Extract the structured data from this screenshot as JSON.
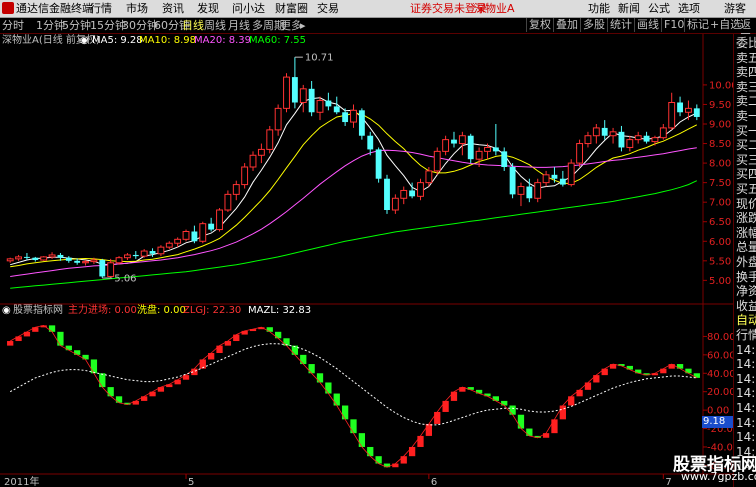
{
  "app": {
    "name": "通达信金融终端"
  },
  "menu": [
    "行情",
    "市场",
    "资讯",
    "发现",
    "问小达",
    "财富圈",
    "交易"
  ],
  "alert_text": "证券交易未登录",
  "stock_title": "深物业A",
  "top_right": [
    "功能",
    "新闻",
    "公式",
    "选项"
  ],
  "guest": "游客",
  "periods": [
    "分时",
    "1分钟",
    "5分钟",
    "15分钟",
    "30分钟",
    "60分钟",
    "日线",
    "周线",
    "月线",
    "多周期",
    "更多"
  ],
  "active_period": "日线",
  "more_arrow": "▸",
  "toolbar": [
    "复权",
    "叠加",
    "多股",
    "统计",
    "画线",
    "F10",
    "标记",
    "+自选",
    "返回"
  ],
  "chart_header": {
    "stock": "深物业A(日线 前复权)",
    "ma": [
      {
        "label": "MA5: 9.28",
        "color": "#ffffff"
      },
      {
        "label": "MA10: 8.98",
        "color": "#ffff00"
      },
      {
        "label": "MA20: 8.39",
        "color": "#ff55ff"
      },
      {
        "label": "MA60: 7.55",
        "color": "#00ff00"
      }
    ]
  },
  "indicator_header": {
    "name": "股票指标网",
    "items": [
      {
        "label": "主力进场: 0.00",
        "color": "#ff3333"
      },
      {
        "label": "洗盘: 0.00",
        "color": "#ffff00"
      },
      {
        "label": "ZLGJ: 22.30",
        "color": "#ff3333"
      },
      {
        "label": "MAZL: 32.83",
        "color": "#ffffff"
      }
    ]
  },
  "right_panel": [
    {
      "t": "委比",
      "c": "white"
    },
    {
      "t": "卖五",
      "c": "white"
    },
    {
      "t": "卖四",
      "c": "white"
    },
    {
      "t": "卖三",
      "c": "white"
    },
    {
      "t": "卖二",
      "c": "white"
    },
    {
      "t": "卖一",
      "c": "white"
    },
    {
      "t": "买一",
      "c": "white"
    },
    {
      "t": "买二",
      "c": "white"
    },
    {
      "t": "买三",
      "c": "white"
    },
    {
      "t": "买四",
      "c": "white"
    },
    {
      "t": "买五",
      "c": "white"
    },
    {
      "t": "现价",
      "c": "white"
    },
    {
      "t": "涨跌",
      "c": "white"
    },
    {
      "t": "涨幅",
      "c": "white"
    },
    {
      "t": "总量",
      "c": "white"
    },
    {
      "t": "外盘",
      "c": "white"
    },
    {
      "t": "换手",
      "c": "white"
    },
    {
      "t": "净资",
      "c": "white"
    },
    {
      "t": "收益",
      "c": "white"
    },
    {
      "t": "自动",
      "c": "yellow"
    },
    {
      "t": "行情",
      "c": "white"
    },
    {
      "t": "14:5",
      "c": "white"
    },
    {
      "t": "14:5",
      "c": "white"
    },
    {
      "t": "14:5",
      "c": "white"
    },
    {
      "t": "14:5",
      "c": "white"
    },
    {
      "t": "14:5",
      "c": "white"
    },
    {
      "t": "14:5",
      "c": "white"
    },
    {
      "t": "14:5",
      "c": "white"
    },
    {
      "t": "14:5",
      "c": "white"
    },
    {
      "t": "14:5",
      "c": "white"
    }
  ],
  "price_box": "9.18",
  "watermark": {
    "line1": "股票指标网",
    "line2": "www.7gpzb.com"
  },
  "annotations": {
    "high": "10.71",
    "low": "5.06"
  },
  "x_labels": [
    "2011年",
    "5",
    "6",
    "7"
  ],
  "chart_data": [
    {
      "type": "candlestick",
      "title": "深物业A(日线 前复权)",
      "ylim": [
        4.6,
        11.2
      ],
      "y_ticks": [
        5.0,
        5.5,
        6.0,
        6.5,
        7.0,
        7.5,
        8.0,
        8.5,
        9.0,
        9.5,
        10.0
      ],
      "candles": [
        [
          5.5,
          5.58,
          5.45,
          5.55
        ],
        [
          5.55,
          5.65,
          5.5,
          5.6
        ],
        [
          5.6,
          5.7,
          5.52,
          5.58
        ],
        [
          5.58,
          5.6,
          5.48,
          5.52
        ],
        [
          5.52,
          5.62,
          5.5,
          5.6
        ],
        [
          5.6,
          5.72,
          5.55,
          5.65
        ],
        [
          5.65,
          5.7,
          5.5,
          5.58
        ],
        [
          5.58,
          5.62,
          5.45,
          5.5
        ],
        [
          5.5,
          5.56,
          5.4,
          5.45
        ],
        [
          5.45,
          5.52,
          5.38,
          5.48
        ],
        [
          5.48,
          5.58,
          5.42,
          5.52
        ],
        [
          5.52,
          5.55,
          5.06,
          5.1
        ],
        [
          5.1,
          5.55,
          5.06,
          5.45
        ],
        [
          5.45,
          5.62,
          5.4,
          5.58
        ],
        [
          5.58,
          5.7,
          5.52,
          5.65
        ],
        [
          5.65,
          5.75,
          5.55,
          5.62
        ],
        [
          5.62,
          5.8,
          5.58,
          5.75
        ],
        [
          5.75,
          5.82,
          5.6,
          5.68
        ],
        [
          5.68,
          5.9,
          5.62,
          5.85
        ],
        [
          5.85,
          6.0,
          5.8,
          5.95
        ],
        [
          5.95,
          6.1,
          5.85,
          6.05
        ],
        [
          6.05,
          6.3,
          6.0,
          6.25
        ],
        [
          6.25,
          6.4,
          5.95,
          6.0
        ],
        [
          6.0,
          6.5,
          5.95,
          6.45
        ],
        [
          6.45,
          6.6,
          6.25,
          6.3
        ],
        [
          6.3,
          6.85,
          6.25,
          6.8
        ],
        [
          6.8,
          7.3,
          6.75,
          7.2
        ],
        [
          7.2,
          7.55,
          7.05,
          7.45
        ],
        [
          7.45,
          8.0,
          7.35,
          7.9
        ],
        [
          7.9,
          8.3,
          7.8,
          8.2
        ],
        [
          8.2,
          8.5,
          8.0,
          8.35
        ],
        [
          8.35,
          8.95,
          8.25,
          8.85
        ],
        [
          8.85,
          9.5,
          8.7,
          9.4
        ],
        [
          9.4,
          10.3,
          9.3,
          10.2
        ],
        [
          10.2,
          10.71,
          9.4,
          9.55
        ],
        [
          9.55,
          10.0,
          9.3,
          9.9
        ],
        [
          9.9,
          10.1,
          9.2,
          9.3
        ],
        [
          9.3,
          9.7,
          9.1,
          9.6
        ],
        [
          9.6,
          9.8,
          9.35,
          9.45
        ],
        [
          9.45,
          9.7,
          9.25,
          9.3
        ],
        [
          9.3,
          9.4,
          8.95,
          9.05
        ],
        [
          9.05,
          9.5,
          8.9,
          9.35
        ],
        [
          9.35,
          9.4,
          8.6,
          8.7
        ],
        [
          8.7,
          8.8,
          8.2,
          8.35
        ],
        [
          8.35,
          8.4,
          7.5,
          7.6
        ],
        [
          7.6,
          7.7,
          6.7,
          6.8
        ],
        [
          6.8,
          7.2,
          6.7,
          7.1
        ],
        [
          7.1,
          7.4,
          6.95,
          7.3
        ],
        [
          7.3,
          7.5,
          7.1,
          7.15
        ],
        [
          7.15,
          7.6,
          7.05,
          7.5
        ],
        [
          7.5,
          7.9,
          7.4,
          7.8
        ],
        [
          7.8,
          8.4,
          7.7,
          8.3
        ],
        [
          8.3,
          8.7,
          8.2,
          8.6
        ],
        [
          8.6,
          8.8,
          8.4,
          8.5
        ],
        [
          8.5,
          8.8,
          8.2,
          8.7
        ],
        [
          8.7,
          8.75,
          8.0,
          8.1
        ],
        [
          8.1,
          8.4,
          7.9,
          8.3
        ],
        [
          8.3,
          8.5,
          8.1,
          8.4
        ],
        [
          8.4,
          9.0,
          8.2,
          8.3
        ],
        [
          8.3,
          8.4,
          7.8,
          7.9
        ],
        [
          7.9,
          8.0,
          7.1,
          7.2
        ],
        [
          7.2,
          7.5,
          6.9,
          7.4
        ],
        [
          7.4,
          7.6,
          7.0,
          7.1
        ],
        [
          7.1,
          7.6,
          7.0,
          7.5
        ],
        [
          7.5,
          7.8,
          7.4,
          7.7
        ],
        [
          7.7,
          7.9,
          7.5,
          7.6
        ],
        [
          7.6,
          7.8,
          7.4,
          7.45
        ],
        [
          7.45,
          8.1,
          7.4,
          8.0
        ],
        [
          8.0,
          8.6,
          7.9,
          8.5
        ],
        [
          8.5,
          8.8,
          8.4,
          8.7
        ],
        [
          8.7,
          9.0,
          8.5,
          8.9
        ],
        [
          8.9,
          9.1,
          8.6,
          8.7
        ],
        [
          8.7,
          8.9,
          8.5,
          8.8
        ],
        [
          8.8,
          8.95,
          8.3,
          8.4
        ],
        [
          8.4,
          8.7,
          8.3,
          8.6
        ],
        [
          8.6,
          8.8,
          8.5,
          8.7
        ],
        [
          8.7,
          8.8,
          8.5,
          8.55
        ],
        [
          8.55,
          8.7,
          8.45,
          8.65
        ],
        [
          8.65,
          9.0,
          8.6,
          8.9
        ],
        [
          8.9,
          9.8,
          8.85,
          9.55
        ],
        [
          9.55,
          9.7,
          9.2,
          9.3
        ],
        [
          9.3,
          9.6,
          9.1,
          9.4
        ],
        [
          9.4,
          9.5,
          9.1,
          9.18
        ]
      ],
      "series": [
        {
          "name": "MA5",
          "color": "#ffffff",
          "values": [
            5.4,
            5.46,
            5.52,
            5.56,
            5.57,
            5.59,
            5.59,
            5.57,
            5.55,
            5.52,
            5.49,
            5.41,
            5.4,
            5.42,
            5.44,
            5.48,
            5.62,
            5.66,
            5.71,
            5.77,
            5.85,
            5.96,
            6.02,
            6.14,
            6.21,
            6.36,
            6.6,
            6.84,
            7.13,
            7.51,
            7.82,
            8.15,
            8.52,
            8.98,
            9.27,
            9.58,
            9.65,
            9.67,
            9.56,
            9.51,
            9.34,
            9.35,
            9.17,
            8.9,
            8.6,
            8.2,
            7.93,
            7.68,
            7.38,
            7.27,
            7.4,
            7.7,
            7.99,
            8.24,
            8.45,
            8.5,
            8.47,
            8.45,
            8.38,
            8.22,
            7.9,
            7.66,
            7.48,
            7.36,
            7.4,
            7.42,
            7.54,
            7.65,
            7.87,
            8.1,
            8.36,
            8.58,
            8.78,
            8.7,
            8.68,
            8.64,
            8.61,
            8.64,
            8.69,
            8.85,
            9.05,
            9.18,
            9.28
          ]
        },
        {
          "name": "MA10",
          "color": "#ffff00",
          "values": [
            5.35,
            5.38,
            5.42,
            5.45,
            5.48,
            5.5,
            5.52,
            5.54,
            5.55,
            5.56,
            5.55,
            5.53,
            5.5,
            5.49,
            5.48,
            5.49,
            5.52,
            5.54,
            5.58,
            5.62,
            5.66,
            5.73,
            5.8,
            5.88,
            5.97,
            6.07,
            6.24,
            6.41,
            6.61,
            6.83,
            7.05,
            7.3,
            7.58,
            7.88,
            8.17,
            8.47,
            8.7,
            8.91,
            9.05,
            9.18,
            9.22,
            9.27,
            9.25,
            9.13,
            8.97,
            8.75,
            8.55,
            8.37,
            8.14,
            7.94,
            7.8,
            7.75,
            7.75,
            7.79,
            7.86,
            7.95,
            8.04,
            8.1,
            8.17,
            8.2,
            8.15,
            8.06,
            7.96,
            7.8,
            7.66,
            7.56,
            7.48,
            7.48,
            7.58,
            7.73,
            7.89,
            8.02,
            8.13,
            8.18,
            8.24,
            8.33,
            8.4,
            8.49,
            8.56,
            8.66,
            8.76,
            8.87,
            8.98
          ]
        },
        {
          "name": "MA20",
          "color": "#ff55ff",
          "values": [
            5.1,
            5.13,
            5.16,
            5.19,
            5.22,
            5.25,
            5.28,
            5.31,
            5.33,
            5.35,
            5.37,
            5.38,
            5.4,
            5.42,
            5.44,
            5.46,
            5.48,
            5.5,
            5.52,
            5.55,
            5.58,
            5.62,
            5.66,
            5.71,
            5.76,
            5.82,
            5.9,
            5.98,
            6.08,
            6.19,
            6.31,
            6.45,
            6.6,
            6.76,
            6.93,
            7.1,
            7.28,
            7.46,
            7.62,
            7.78,
            7.93,
            8.06,
            8.18,
            8.26,
            8.32,
            8.33,
            8.32,
            8.3,
            8.27,
            8.23,
            8.18,
            8.14,
            8.1,
            8.06,
            8.02,
            7.99,
            7.97,
            7.95,
            7.94,
            7.93,
            7.92,
            7.91,
            7.9,
            7.89,
            7.89,
            7.9,
            7.91,
            7.93,
            7.95,
            7.98,
            8.01,
            8.04,
            8.07,
            8.09,
            8.12,
            8.15,
            8.18,
            8.21,
            8.24,
            8.28,
            8.32,
            8.36,
            8.39
          ]
        },
        {
          "name": "MA60",
          "color": "#00ff00",
          "values": [
            4.8,
            4.82,
            4.84,
            4.86,
            4.88,
            4.9,
            4.92,
            4.94,
            4.96,
            4.98,
            5.0,
            5.02,
            5.04,
            5.06,
            5.08,
            5.1,
            5.12,
            5.14,
            5.16,
            5.18,
            5.2,
            5.22,
            5.25,
            5.28,
            5.31,
            5.34,
            5.37,
            5.4,
            5.44,
            5.48,
            5.52,
            5.56,
            5.6,
            5.65,
            5.7,
            5.75,
            5.8,
            5.85,
            5.9,
            5.95,
            6.0,
            6.04,
            6.08,
            6.12,
            6.16,
            6.2,
            6.24,
            6.27,
            6.3,
            6.33,
            6.36,
            6.39,
            6.42,
            6.45,
            6.48,
            6.51,
            6.54,
            6.57,
            6.6,
            6.63,
            6.66,
            6.69,
            6.72,
            6.75,
            6.78,
            6.81,
            6.84,
            6.87,
            6.9,
            6.93,
            6.96,
            6.99,
            7.02,
            7.06,
            7.1,
            7.14,
            7.18,
            7.22,
            7.27,
            7.32,
            7.38,
            7.45,
            7.55
          ]
        }
      ]
    },
    {
      "type": "bar",
      "title": "股票指标网",
      "ylim": [
        -65,
        100
      ],
      "y_ticks": [
        80.0,
        60.0,
        40.0,
        20.0,
        0.0,
        -20.0,
        -40.0,
        -60.0
      ],
      "zlgj": [
        75,
        80,
        85,
        90,
        92,
        85,
        70,
        65,
        60,
        55,
        40,
        25,
        15,
        8,
        6,
        10,
        15,
        20,
        25,
        28,
        33,
        38,
        45,
        55,
        62,
        70,
        75,
        82,
        86,
        88,
        90,
        85,
        78,
        70,
        60,
        50,
        40,
        30,
        18,
        5,
        -10,
        -25,
        -40,
        -50,
        -58,
        -62,
        -58,
        -50,
        -40,
        -28,
        -15,
        -2,
        10,
        20,
        25,
        22,
        18,
        15,
        10,
        5,
        -5,
        -20,
        -28,
        -30,
        -25,
        -10,
        5,
        15,
        22,
        30,
        38,
        45,
        50,
        48,
        44,
        40,
        38,
        40,
        45,
        50,
        45,
        40,
        35
      ],
      "series": [
        {
          "name": "MAZL",
          "color": "#ffffff",
          "values": [
            20,
            25,
            30,
            35,
            38,
            41,
            43,
            44,
            44,
            43,
            41,
            39,
            37,
            35,
            33,
            32,
            31,
            31,
            32,
            34,
            36,
            39,
            42,
            46,
            50,
            54,
            58,
            62,
            66,
            69,
            71,
            72,
            72,
            71,
            69,
            66,
            62,
            57,
            51,
            45,
            38,
            31,
            24,
            17,
            10,
            3,
            -3,
            -8,
            -12,
            -15,
            -16,
            -16,
            -14,
            -11,
            -8,
            -5,
            -2,
            0,
            1,
            2,
            2,
            1,
            -1,
            -2,
            -2,
            -1,
            1,
            4,
            8,
            12,
            16,
            20,
            24,
            27,
            30,
            32,
            34,
            35,
            36,
            37,
            37,
            36,
            35
          ]
        }
      ]
    }
  ]
}
